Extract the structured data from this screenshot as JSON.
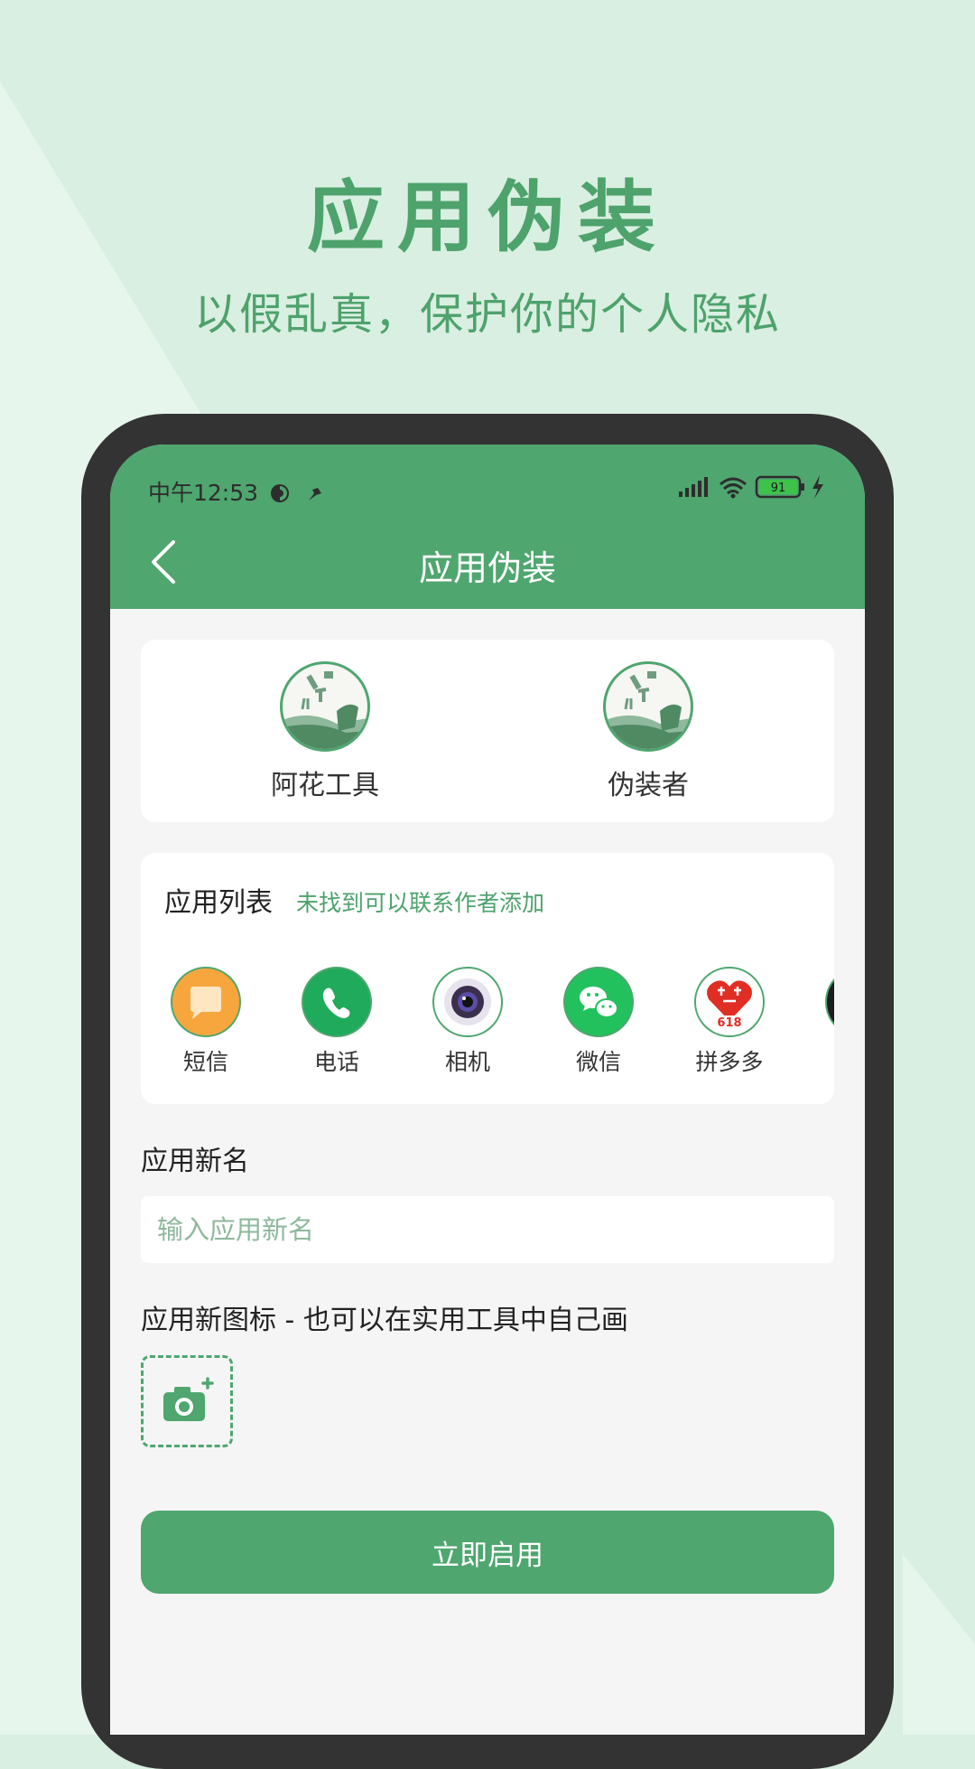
{
  "marketing": {
    "headline": "应用伪装",
    "subtitle": "以假乱真，保护你的个人隐私"
  },
  "status_bar": {
    "time": "中午12:53",
    "battery": "91"
  },
  "app_bar": {
    "back_icon": "chevron-left-icon",
    "title": "应用伪装"
  },
  "disguise_pair": {
    "original_label": "阿花工具",
    "disguiser_label": "伪装者"
  },
  "app_list": {
    "title": "应用列表",
    "hint": "未找到可以联系作者添加",
    "items": [
      {
        "label": "短信",
        "icon": "sms-icon",
        "color": "#f7a63e"
      },
      {
        "label": "电话",
        "icon": "phone-icon",
        "color": "#1faa5c"
      },
      {
        "label": "相机",
        "icon": "camera-icon",
        "color": "#3b2f4d"
      },
      {
        "label": "微信",
        "icon": "wechat-icon",
        "color": "#22c15e"
      },
      {
        "label": "拼多多",
        "icon": "pinduoduo-icon",
        "color": "#e02e24"
      }
    ]
  },
  "new_name": {
    "label": "应用新名",
    "placeholder": "输入应用新名",
    "value": ""
  },
  "new_icon": {
    "label": "应用新图标 - 也可以在实用工具中自己画",
    "picker_icon": "add-photo-icon"
  },
  "enable_button": "立即启用",
  "colors": {
    "accent": "#4fa66f",
    "background": "#d9efe1",
    "phone_frame": "#333333"
  }
}
